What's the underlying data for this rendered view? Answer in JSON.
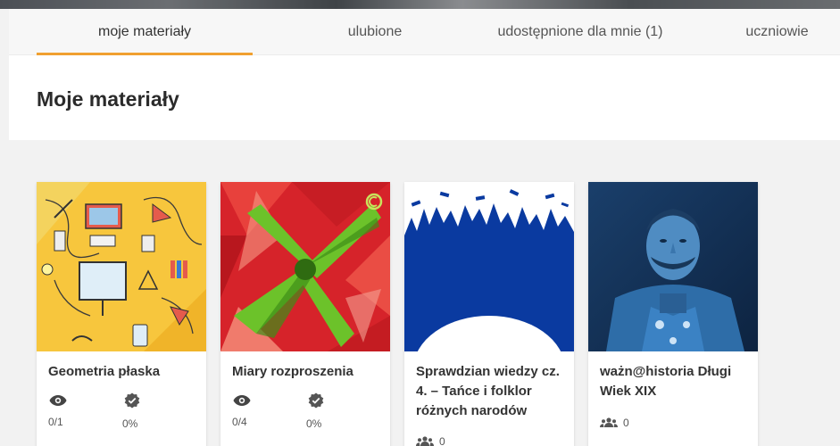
{
  "tabs": [
    {
      "label": "moje materiały",
      "active": true
    },
    {
      "label": "ulubione",
      "active": false
    },
    {
      "label": "udostępnione dla mnie (1)",
      "active": false
    },
    {
      "label": "uczniowie",
      "active": false
    }
  ],
  "accent_color": "#f0a030",
  "page_title": "Moje materiały",
  "cards": [
    {
      "title": "Geometria płaska",
      "views": "0/1",
      "score": "0%"
    },
    {
      "title": "Miary rozproszenia",
      "views": "0/4",
      "score": "0%"
    },
    {
      "title": "Sprawdzian wiedzy cz. 4. – Tańce i folklor różnych narodów",
      "members": "0"
    },
    {
      "title": "ważn@historia Długi Wiek XIX",
      "members": "0"
    }
  ],
  "icons": {
    "views": "eye-icon",
    "score": "verified-badge-icon",
    "members": "group-icon"
  }
}
